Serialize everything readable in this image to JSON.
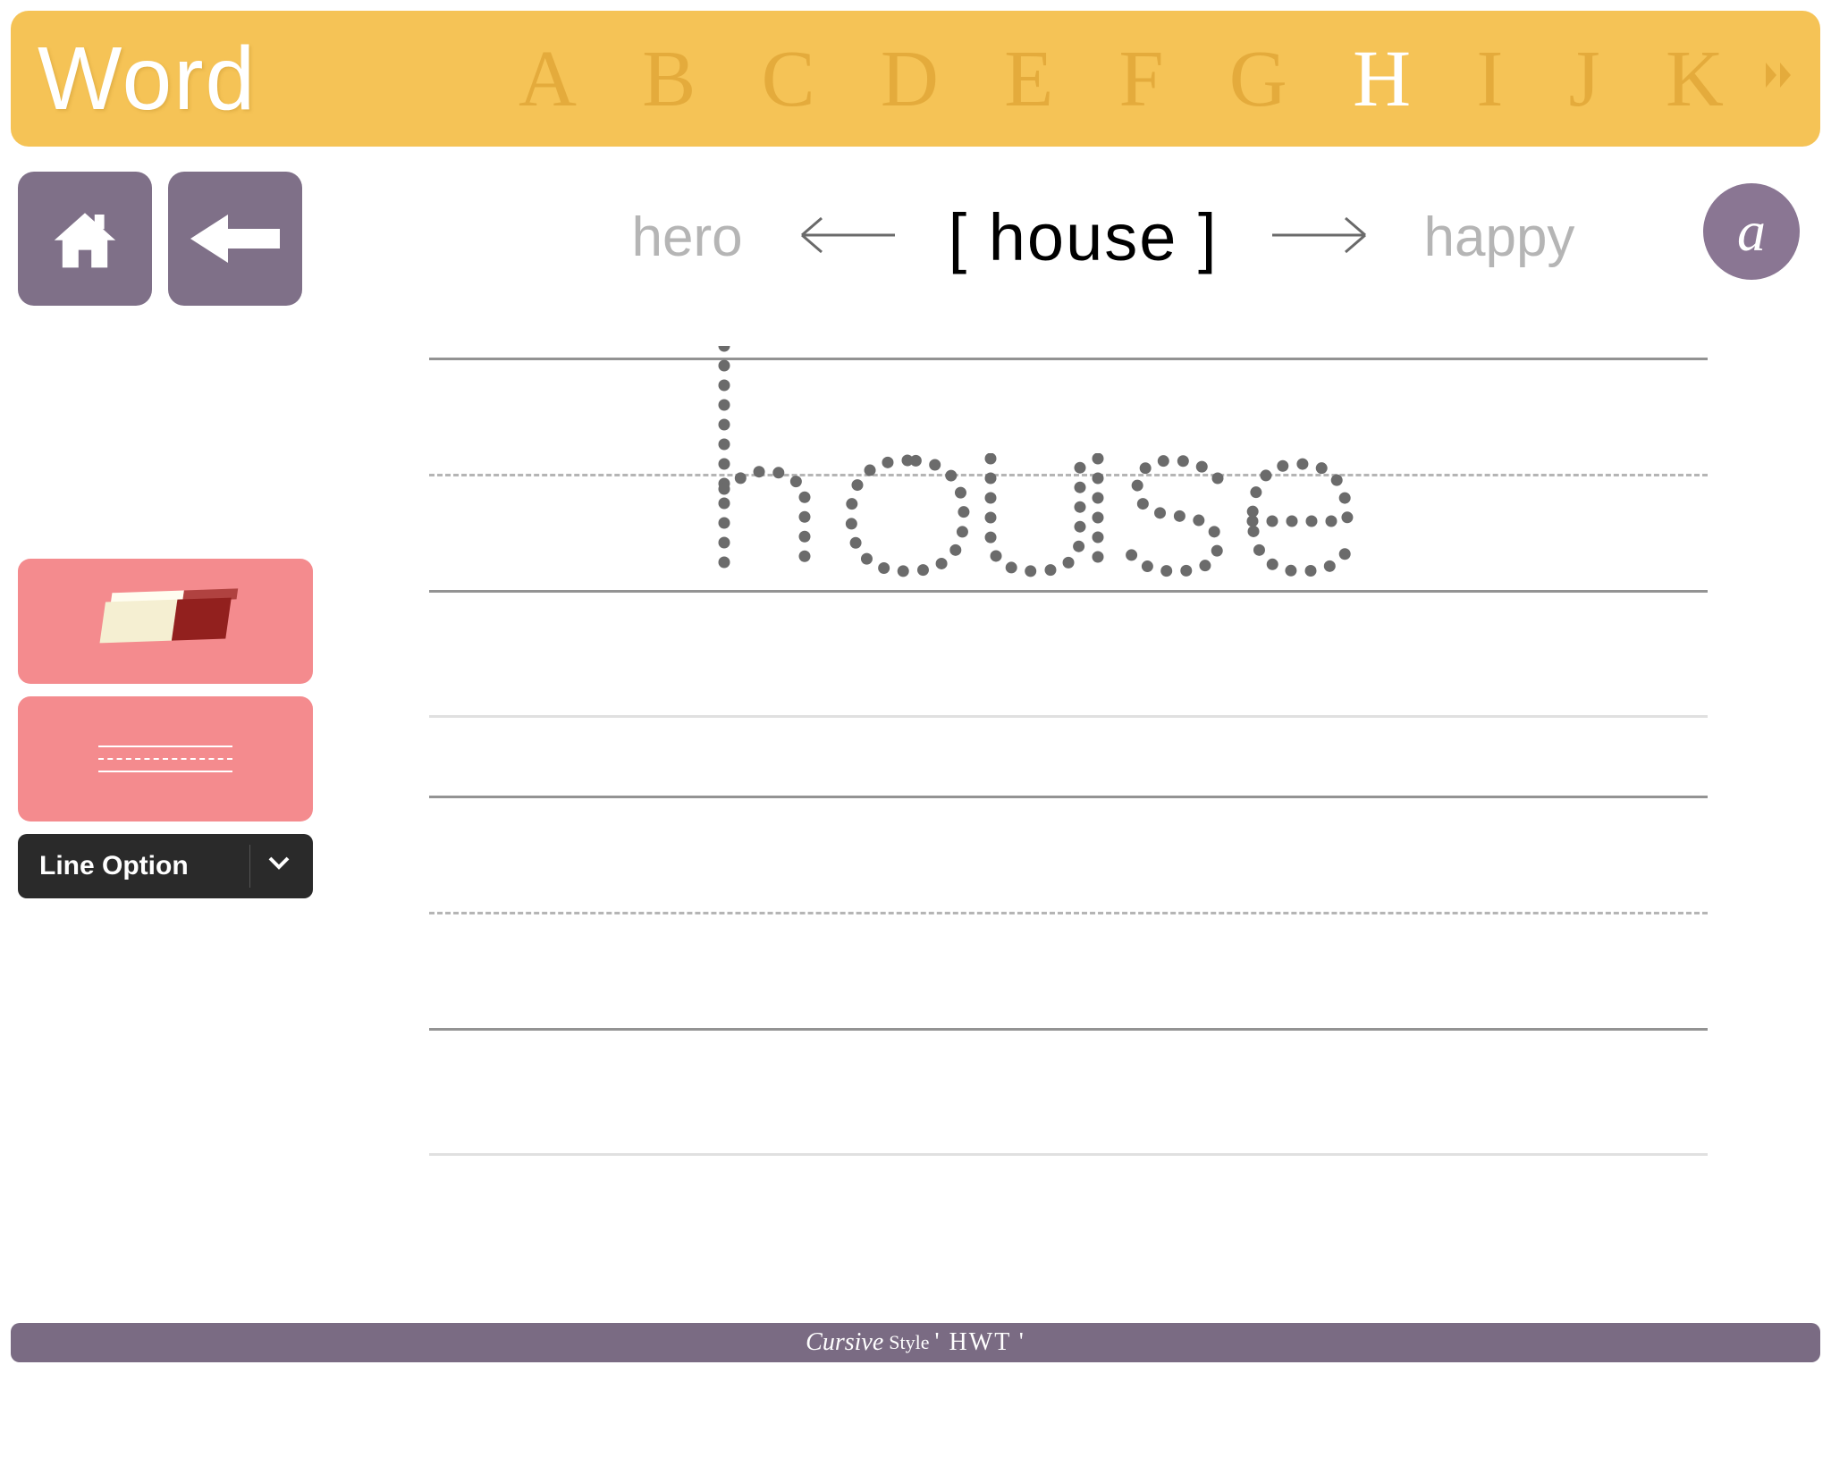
{
  "header": {
    "title": "Word",
    "letters": [
      "A",
      "B",
      "C",
      "D",
      "E",
      "F",
      "G",
      "H",
      "I",
      "J",
      "K"
    ],
    "active_index": 7
  },
  "wordnav": {
    "prev": "hero",
    "current": "[ house ]",
    "next": "happy"
  },
  "sidebar": {
    "dropdown_label": "Line Option"
  },
  "trace": {
    "word": "house"
  },
  "badge": {
    "letter": "a"
  },
  "footer": {
    "cursive": "Cursive",
    "style": "Style",
    "name": "' HWT '"
  },
  "colors": {
    "header_bg": "#f5c356",
    "nav_bg": "#7f7088",
    "tool_bg": "#f48b8e",
    "footer_bg": "#7a6b83"
  }
}
